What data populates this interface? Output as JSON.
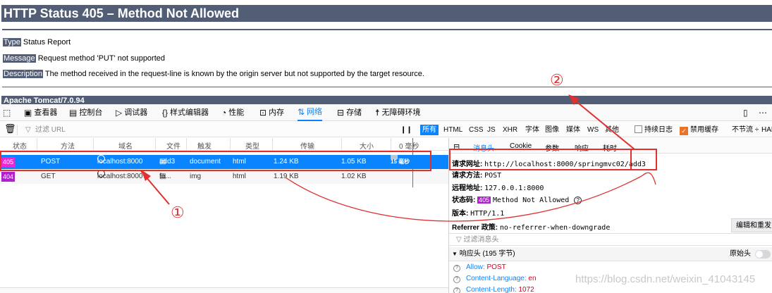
{
  "error_page": {
    "title": "HTTP Status 405 – Method Not Allowed",
    "type_label": "Type",
    "type_value": "Status Report",
    "message_label": "Message",
    "message_value": "Request method 'PUT' not supported",
    "description_label": "Description",
    "description_value": "The method received in the request-line is known by the origin server but not supported by the target resource.",
    "footer": "Apache Tomcat/7.0.94"
  },
  "devtools": {
    "tabs": [
      {
        "label": "查看器",
        "icon": "inspector-icon"
      },
      {
        "label": "控制台",
        "icon": "console-icon"
      },
      {
        "label": "调试器",
        "icon": "debugger-icon"
      },
      {
        "label": "样式编辑器",
        "icon": "style-editor-icon"
      },
      {
        "label": "性能",
        "icon": "performance-icon"
      },
      {
        "label": "内存",
        "icon": "memory-icon"
      },
      {
        "label": "网络",
        "icon": "network-icon"
      },
      {
        "label": "存储",
        "icon": "storage-icon"
      },
      {
        "label": "无障碍环境",
        "icon": "accessibility-icon"
      }
    ],
    "active_tab": "网络",
    "filter_placeholder": "过滤 URL",
    "filter_types": [
      "所有",
      "HTML",
      "CSS",
      "JS",
      "XHR",
      "字体",
      "图像",
      "媒体",
      "WS",
      "其他"
    ],
    "persist_logs": "持续日志",
    "disable_cache": "禁用缓存",
    "throttle": "不节流 ÷",
    "throttle_extra": "HAR",
    "columns": [
      "状态",
      "方法",
      "域名",
      "文件",
      "触发",
      "类型",
      "传输",
      "大小",
      "0 毫秒"
    ],
    "requests": [
      {
        "status": "405",
        "method": "POST",
        "domain": "localhost:8000",
        "file": "add3",
        "trigger": "document",
        "type": "html",
        "transferred": "1.24 KB",
        "size": "1.05 KB",
        "time": "15 毫秒"
      },
      {
        "status": "404",
        "method": "GET",
        "domain": "localhost:8000",
        "file": "fa...",
        "trigger": "img",
        "type": "html",
        "transferred": "1.19 KB",
        "size": "1.02 KB",
        "time": ""
      }
    ],
    "detail_tabs": [
      "消息头",
      "Cookie",
      "参数",
      "响应",
      "耗时"
    ],
    "detail": {
      "url_label": "请求网址:",
      "url_value": "http://localhost:8000/springmvc02/add3",
      "method_label": "请求方法:",
      "method_value": "POST",
      "remote_label": "远程地址:",
      "remote_value": "127.0.0.1:8000",
      "status_label": "状态码:",
      "status_code": "405",
      "status_text": "Method Not Allowed",
      "version_label": "版本:",
      "version_value": "HTTP/1.1",
      "referrer_label": "Referrer 政策:",
      "referrer_value": "no-referrer-when-downgrade",
      "edit_resend": "编辑和重发",
      "filter_headers": "过滤消息头",
      "response_headers": "响应头 (195 字节)",
      "raw_headers": "原始头",
      "headers": [
        {
          "key": "Allow:",
          "value": "POST"
        },
        {
          "key": "Content-Language:",
          "value": "en"
        },
        {
          "key": "Content-Length:",
          "value": "1072"
        }
      ]
    }
  },
  "annotations": {
    "one": "①",
    "two": "②"
  },
  "watermark": "https://blog.csdn.net/weixin_41043145",
  "colors": {
    "tomcat": "#525d76",
    "accent": "#0a84ff",
    "annotation": "#e03030"
  }
}
